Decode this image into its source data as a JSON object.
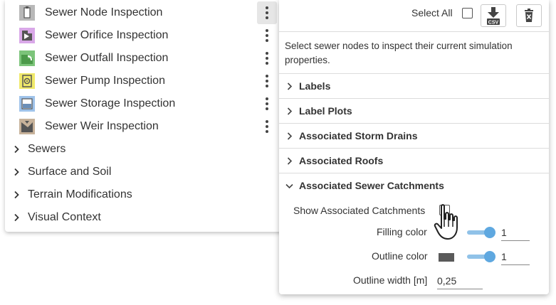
{
  "tools": [
    {
      "label": "Sewer Node Inspection",
      "icon": "sewer-node-icon",
      "color": "#b8b8b8"
    },
    {
      "label": "Sewer Orifice Inspection",
      "icon": "sewer-orifice-icon",
      "color": "#d9a8e8"
    },
    {
      "label": "Sewer Outfall Inspection",
      "icon": "sewer-outfall-icon",
      "color": "#7cc47a"
    },
    {
      "label": "Sewer Pump Inspection",
      "icon": "sewer-pump-icon",
      "color": "#f0e96a"
    },
    {
      "label": "Sewer Storage Inspection",
      "icon": "sewer-storage-icon",
      "color": "#9fc3ea"
    },
    {
      "label": "Sewer Weir Inspection",
      "icon": "sewer-weir-icon",
      "color": "#c7b29a"
    }
  ],
  "groups": [
    "Sewers",
    "Surface and Soil",
    "Terrain Modifications",
    "Visual Context"
  ],
  "panel": {
    "select_all_label": "Select All",
    "csv_label": "CSV",
    "description": "Select sewer nodes to inspect their current simulation properties.",
    "sections": [
      "Labels",
      "Label Plots",
      "Associated Storm Drains",
      "Associated Roofs",
      "Associated Sewer Catchments"
    ],
    "catchments": {
      "show_label": "Show Associated Catchments",
      "filling_label": "Filling color",
      "filling_value": "1",
      "outline_label": "Outline color",
      "outline_value": "1",
      "outline_swatch": "#5a5a5a",
      "width_label": "Outline width [m]",
      "width_value": "0,25"
    }
  },
  "colors": {
    "accent": "#5fa8e0",
    "accent_light": "#90c2e8"
  }
}
